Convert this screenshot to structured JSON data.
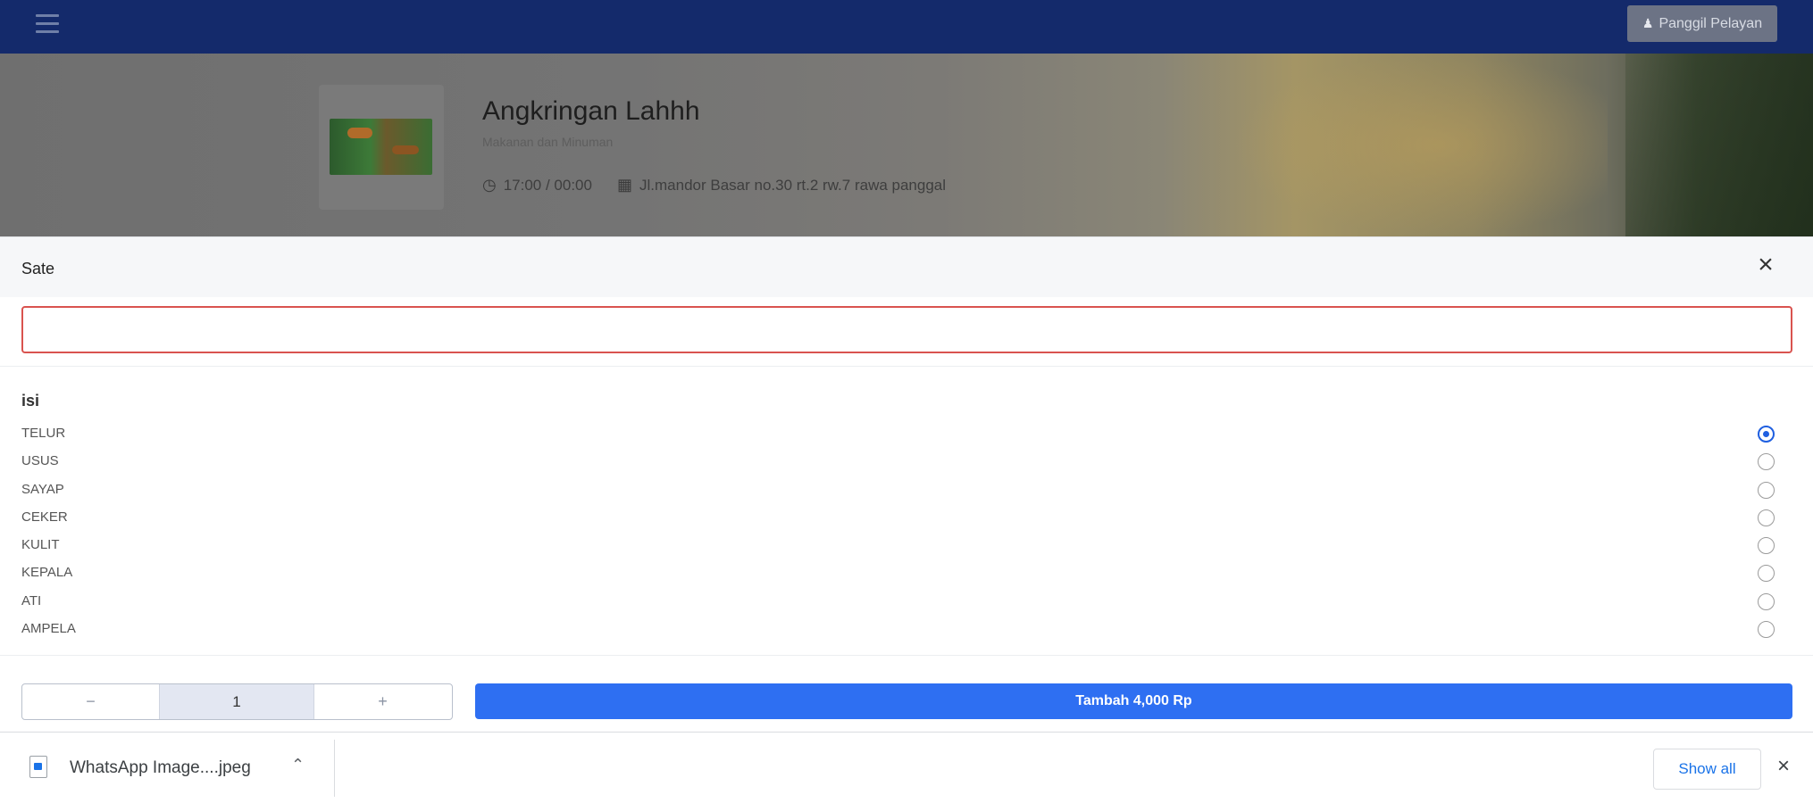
{
  "navbar": {
    "call_waiter_label": "Panggil Pelayan",
    "menu_icon": "hamburger-icon",
    "user_icon": "user-icon"
  },
  "restaurant": {
    "name": "Angkringan Lahhh",
    "subtitle": "Makanan dan Minuman",
    "hours": "17:00 / 00:00",
    "address": "Jl.mandor Basar no.30 rt.2 rw.7 rawa panggal"
  },
  "modal": {
    "title": "Sate",
    "note_placeholder": "",
    "note_value": "",
    "group_title": "isi",
    "options": [
      {
        "label": "TELUR",
        "selected": true
      },
      {
        "label": "USUS",
        "selected": false
      },
      {
        "label": "SAYAP",
        "selected": false
      },
      {
        "label": "CEKER",
        "selected": false
      },
      {
        "label": "KULIT",
        "selected": false
      },
      {
        "label": "KEPALA",
        "selected": false
      },
      {
        "label": "ATI",
        "selected": false
      },
      {
        "label": "AMPELA",
        "selected": false
      }
    ],
    "quantity": "1",
    "minus_label": "−",
    "plus_label": "+",
    "add_button_label": "Tambah 4,000 Rp"
  },
  "download_bar": {
    "file_name": "WhatsApp Image....jpeg",
    "show_all_label": "Show all"
  },
  "colors": {
    "navbar": "#142a6b",
    "primary": "#2e6ff2",
    "input_error_border": "#d9534f"
  }
}
